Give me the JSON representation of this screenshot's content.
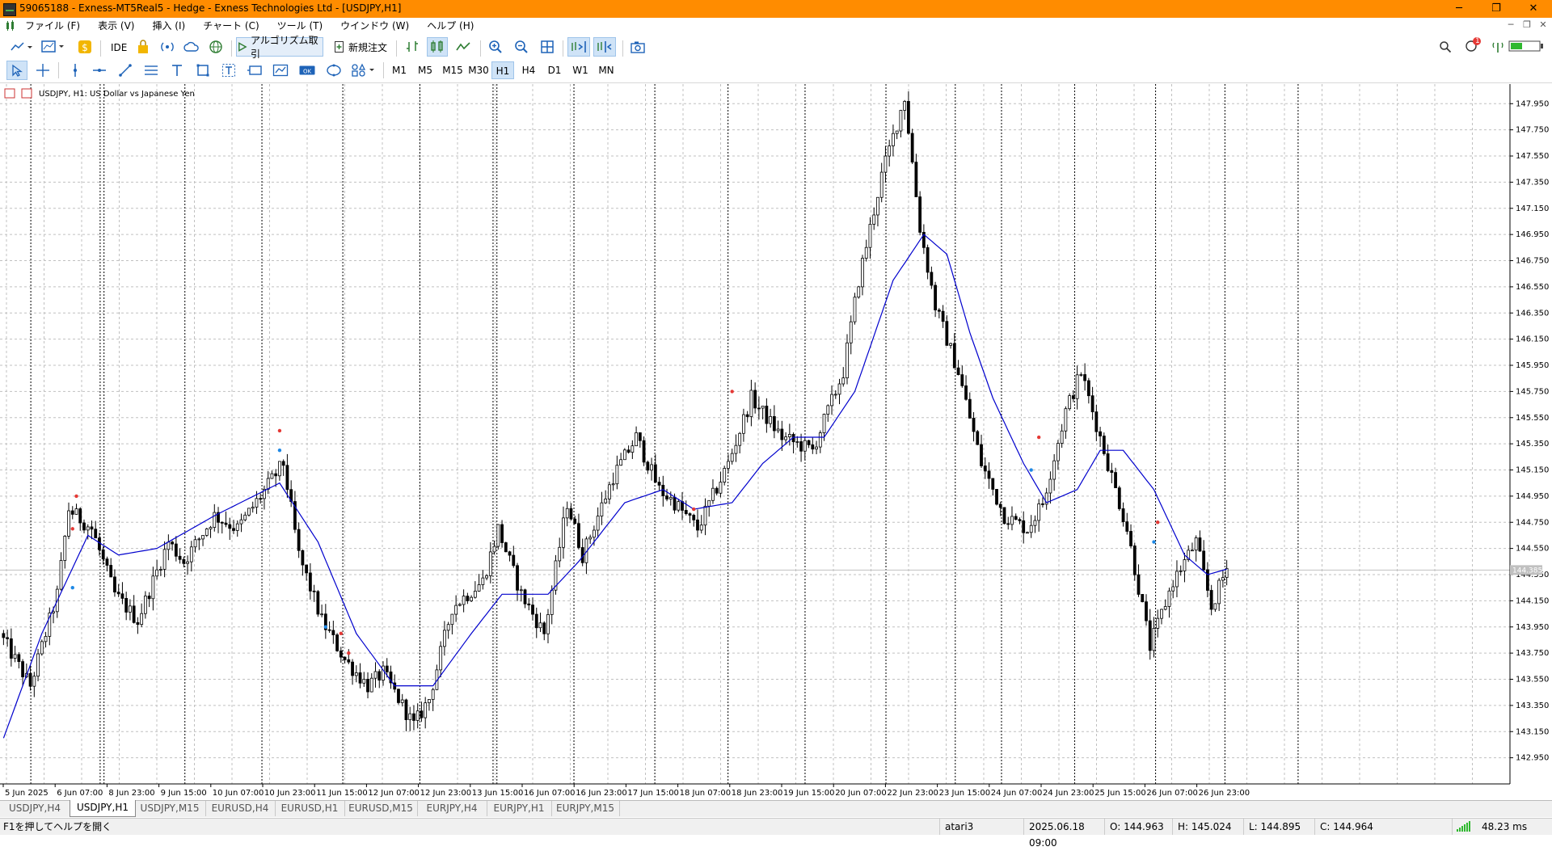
{
  "window": {
    "title": "59065188 - Exness-MT5Real5 - Hedge - Exness Technologies Ltd - [USDJPY,H1]",
    "minimize": "─",
    "restore": "❐",
    "close": "✕"
  },
  "menu": {
    "items": [
      "ファイル (F)",
      "表示 (V)",
      "挿入 (I)",
      "チャート (C)",
      "ツール (T)",
      "ウインドウ (W)",
      "ヘルプ (H)"
    ]
  },
  "toolbar": {
    "ide_label": "IDE",
    "algo_label": "アルゴリズム取引",
    "new_order_label": "新規注文",
    "notification_count": "1",
    "timeframes": [
      "M1",
      "M5",
      "M15",
      "M30",
      "H1",
      "H4",
      "D1",
      "W1",
      "MN"
    ],
    "active_timeframe": "H1"
  },
  "chart_data": {
    "type": "candlestick",
    "title": "USDJPY, H1:  US Dollar vs Japanese Yen",
    "ylim": [
      142.75,
      148.1
    ],
    "y_ticks": [
      "147.950",
      "147.750",
      "147.550",
      "147.350",
      "147.150",
      "146.950",
      "146.750",
      "146.550",
      "146.350",
      "146.150",
      "145.950",
      "145.750",
      "145.550",
      "145.350",
      "145.150",
      "144.950",
      "144.750",
      "144.550",
      "144.350",
      "144.150",
      "143.950",
      "143.750",
      "143.550",
      "143.350",
      "143.150",
      "142.950"
    ],
    "x_ticks": [
      "5 Jun 2025",
      "6 Jun 07:00",
      "8 Jun 23:00",
      "9 Jun 15:00",
      "10 Jun 07:00",
      "10 Jun 23:00",
      "11 Jun 15:00",
      "12 Jun 07:00",
      "12 Jun 23:00",
      "13 Jun 15:00",
      "16 Jun 07:00",
      "16 Jun 23:00",
      "17 Jun 15:00",
      "18 Jun 07:00",
      "18 Jun 23:00",
      "19 Jun 15:00",
      "20 Jun 07:00",
      "22 Jun 23:00",
      "23 Jun 15:00",
      "24 Jun 07:00",
      "24 Jun 23:00",
      "25 Jun 15:00",
      "26 Jun 07:00",
      "26 Jun 23:00"
    ],
    "current_price": "144.385",
    "price_path": [
      [
        0,
        143.9
      ],
      [
        8,
        143.5
      ],
      [
        15,
        144.2
      ],
      [
        18,
        144.85
      ],
      [
        24,
        144.7
      ],
      [
        30,
        144.2
      ],
      [
        36,
        144.0
      ],
      [
        44,
        144.6
      ],
      [
        48,
        144.45
      ],
      [
        56,
        144.8
      ],
      [
        62,
        144.7
      ],
      [
        74,
        145.2
      ],
      [
        78,
        144.5
      ],
      [
        84,
        144.0
      ],
      [
        90,
        143.7
      ],
      [
        96,
        143.5
      ],
      [
        100,
        143.6
      ],
      [
        108,
        143.2
      ],
      [
        112,
        143.4
      ],
      [
        118,
        144.1
      ],
      [
        126,
        144.3
      ],
      [
        130,
        144.7
      ],
      [
        136,
        144.2
      ],
      [
        142,
        143.9
      ],
      [
        148,
        144.9
      ],
      [
        152,
        144.5
      ],
      [
        160,
        145.1
      ],
      [
        166,
        145.4
      ],
      [
        172,
        145.0
      ],
      [
        176,
        144.9
      ],
      [
        182,
        144.7
      ],
      [
        190,
        145.2
      ],
      [
        196,
        145.7
      ],
      [
        204,
        145.4
      ],
      [
        212,
        145.3
      ],
      [
        220,
        145.9
      ],
      [
        224,
        146.6
      ],
      [
        230,
        147.4
      ],
      [
        236,
        148.0
      ],
      [
        240,
        147.0
      ],
      [
        244,
        146.4
      ],
      [
        250,
        145.9
      ],
      [
        256,
        145.2
      ],
      [
        262,
        144.8
      ],
      [
        268,
        144.7
      ],
      [
        272,
        144.9
      ],
      [
        278,
        145.6
      ],
      [
        282,
        145.9
      ],
      [
        288,
        145.3
      ],
      [
        294,
        144.7
      ],
      [
        300,
        143.8
      ],
      [
        306,
        144.3
      ],
      [
        312,
        144.6
      ],
      [
        316,
        144.1
      ],
      [
        320,
        144.4
      ]
    ],
    "ma_path": [
      [
        0,
        143.1
      ],
      [
        10,
        143.9
      ],
      [
        22,
        144.65
      ],
      [
        30,
        144.5
      ],
      [
        40,
        144.55
      ],
      [
        55,
        144.8
      ],
      [
        72,
        145.05
      ],
      [
        82,
        144.6
      ],
      [
        92,
        143.9
      ],
      [
        102,
        143.5
      ],
      [
        112,
        143.5
      ],
      [
        122,
        143.9
      ],
      [
        130,
        144.2
      ],
      [
        142,
        144.2
      ],
      [
        150,
        144.45
      ],
      [
        162,
        144.9
      ],
      [
        172,
        145.0
      ],
      [
        180,
        144.85
      ],
      [
        190,
        144.9
      ],
      [
        198,
        145.2
      ],
      [
        206,
        145.4
      ],
      [
        214,
        145.4
      ],
      [
        222,
        145.75
      ],
      [
        232,
        146.6
      ],
      [
        240,
        146.95
      ],
      [
        246,
        146.8
      ],
      [
        252,
        146.2
      ],
      [
        258,
        145.7
      ],
      [
        266,
        145.2
      ],
      [
        272,
        144.9
      ],
      [
        280,
        145.0
      ],
      [
        286,
        145.3
      ],
      [
        292,
        145.3
      ],
      [
        300,
        145.0
      ],
      [
        308,
        144.5
      ],
      [
        314,
        144.35
      ],
      [
        320,
        144.4
      ]
    ],
    "bar_count": 320,
    "period_breaks": [
      8,
      26,
      27,
      48,
      68,
      89,
      109,
      128,
      129,
      149,
      170,
      189,
      209,
      230,
      248,
      260,
      279,
      300,
      318,
      337
    ],
    "colors": {
      "candle": "#000000",
      "ma": "#0000cd",
      "grid": "#c0c0c0",
      "current_line": "#c0c0c0",
      "signal_up": "#1e88e5",
      "signal_down": "#e53935"
    }
  },
  "tabs": [
    "USDJPY,H4",
    "USDJPY,H1",
    "USDJPY,M15",
    "EURUSD,H4",
    "EURUSD,H1",
    "EURUSD,M15",
    "EURJPY,H4",
    "EURJPY,H1",
    "EURJPY,M15"
  ],
  "active_tab": "USDJPY,H1",
  "status": {
    "help": "F1を押してヘルプを開く",
    "profile": "atari3",
    "datetime": "2025.06.18 09:00",
    "open": "O: 144.963",
    "high": "H: 145.024",
    "low": "L: 144.895",
    "close": "C: 144.964",
    "ping": "48.23 ms"
  }
}
